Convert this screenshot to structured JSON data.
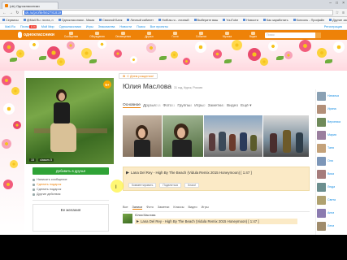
{
  "browser": {
    "tab_title": "(ok) Одноклассники",
    "url": "ok.ru/profile/562781819",
    "bookmarks": [
      "Сервисы",
      "@Mail.Ru: почта, п",
      "Одноклассники - Мама",
      "Связной Банк",
      "Личный кабинет",
      "HotKas.ru - личный",
      "Выберите ваш",
      "YouTube",
      "Новости",
      "Как заработать",
      "Консоль - Профайл",
      "Другие закладки"
    ]
  },
  "mailru": {
    "items": [
      "Mail.Ru",
      "Почта",
      "Мой Мир",
      "Одноклассники",
      "Игры",
      "Знакомства",
      "Новости",
      "Поиск",
      "Все проекты"
    ],
    "mail_count": "104",
    "right_link": "Регистрация"
  },
  "ok_header": {
    "logo_text": "одноклассники",
    "tools": [
      "Сообщения",
      "Обсуждения",
      "Оповещения",
      "Друзья",
      "Гости",
      "События",
      "Музыка",
      "Видео"
    ],
    "search_placeholder": "Поиск"
  },
  "profile": {
    "level_badge": "5+",
    "photo_stats": [
      "15",
      "classes 5"
    ],
    "add_friend_label": "Добавить в друзья",
    "actions": [
      {
        "label": "Написать сообщение",
        "money": false
      },
      {
        "label": "Сделать подарок",
        "money": true
      },
      {
        "label": "Сделать подарок",
        "money": false
      },
      {
        "label": "Другие действия",
        "money": false
      }
    ],
    "wish_title": "Ее желания"
  },
  "main": {
    "birthday_label": "С Днем рождения!",
    "name": "Юлия Маслова",
    "meta": "31 год, Курск, Россия",
    "tabs": [
      {
        "label": "Основное",
        "count": "",
        "active": true
      },
      {
        "label": "Друзья",
        "count": "218",
        "active": false
      },
      {
        "label": "Фото",
        "count": "11",
        "active": false
      },
      {
        "label": "Группы",
        "count": "8",
        "active": false
      },
      {
        "label": "Игры",
        "count": "2",
        "active": false
      },
      {
        "label": "Заметки",
        "count": "1",
        "active": false
      },
      {
        "label": "Видео",
        "count": "",
        "active": false
      },
      {
        "label": "Ещё ▾",
        "count": "",
        "active": false
      }
    ],
    "music_track": "Lana Del Rey - High By The Beach (Vidula Remix 2015 Honeymoon) [ 1:47 ]",
    "music_actions": [
      "Комментировать",
      "Поделиться",
      "Класс!"
    ],
    "feed_tabs": [
      {
        "label": "Все",
        "active": false
      },
      {
        "label": "Записи",
        "active": true
      },
      {
        "label": "Фото",
        "active": false
      },
      {
        "label": "Заметки",
        "active": false
      },
      {
        "label": "Классы",
        "active": false
      },
      {
        "label": "Видео",
        "active": false
      },
      {
        "label": "Игры",
        "active": false
      }
    ],
    "feed_author": "Юлия Маслова",
    "feed_track": "Lana Del Rey - High By The Beach (Vidula Remix 2015 Honeymoon) [ 1:47 ]"
  },
  "friends": {
    "items": [
      "Наталья",
      "Ирина",
      "Вероника",
      "Мария",
      "Таня",
      "Оля",
      "Вика",
      "Люда",
      "Света",
      "Анна",
      "Лена"
    ],
    "colors": [
      "#8aa1b4",
      "#b39079",
      "#6f8a5a",
      "#9a7e9e",
      "#c4a27a",
      "#7c96b8",
      "#a67c7c",
      "#6c8f8f",
      "#b0a270",
      "#8b7bb0",
      "#a08c6c"
    ]
  }
}
